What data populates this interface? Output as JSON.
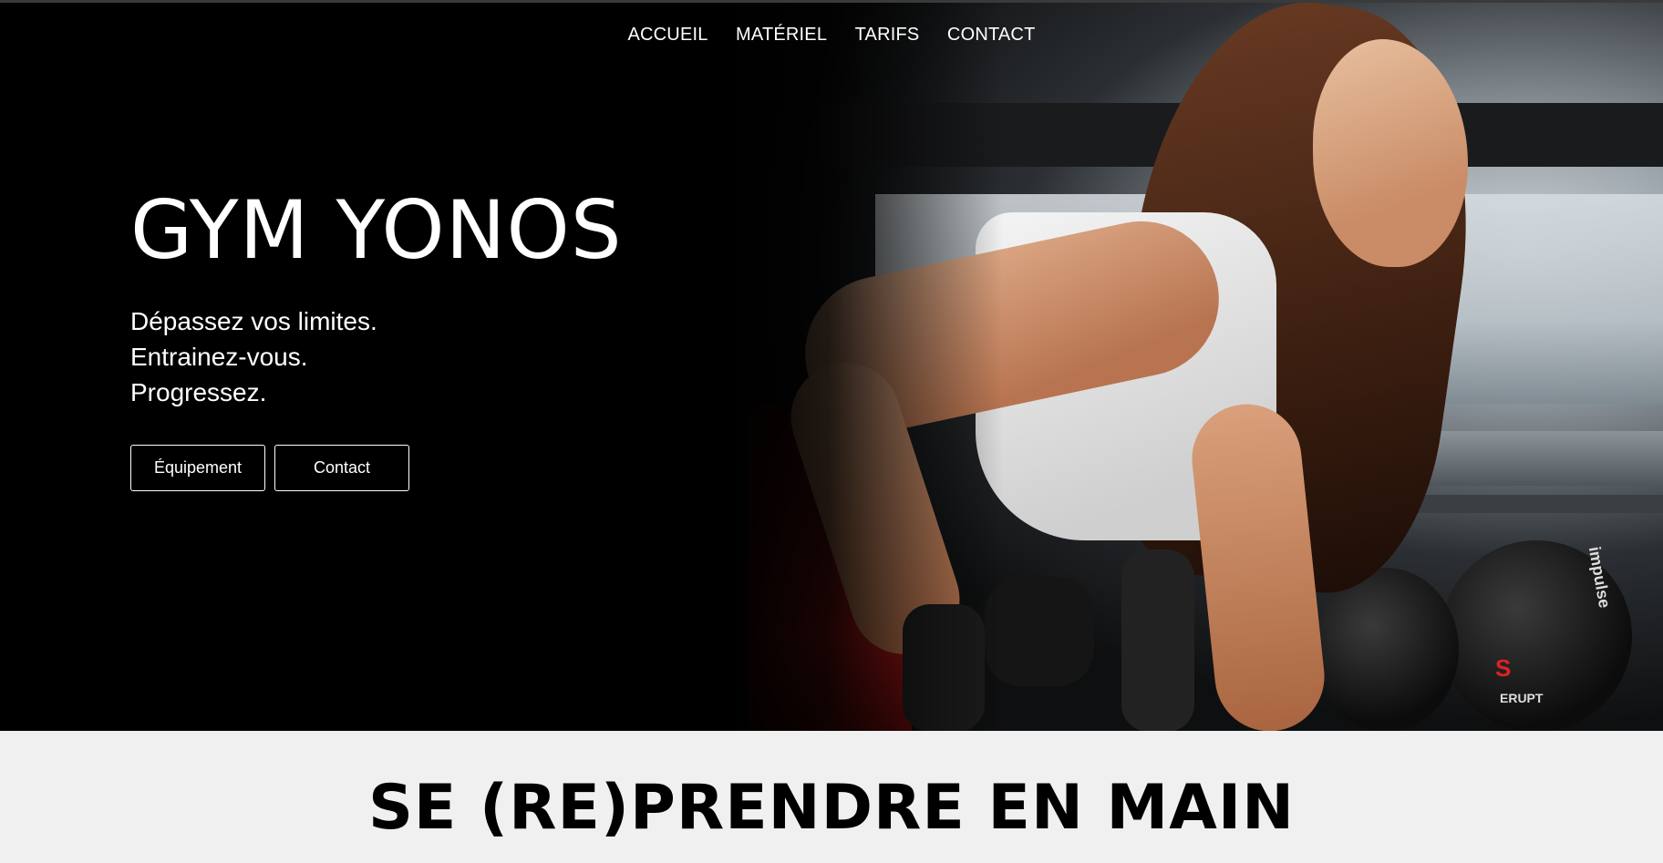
{
  "nav": {
    "items": [
      {
        "label": "ACCUEIL"
      },
      {
        "label": "MATÉRIEL"
      },
      {
        "label": "TARIFS"
      },
      {
        "label": "CONTACT"
      }
    ]
  },
  "hero": {
    "title": "GYM YONOS",
    "tagline": [
      "Dépassez vos limites.",
      "Entrainez-vous.",
      "Progressez."
    ],
    "buttons": [
      {
        "label": "Équipement"
      },
      {
        "label": "Contact"
      }
    ],
    "image": "woman-lifting-dumbbell-photo",
    "plate_brand": "ERUPT",
    "plate_text": "impulse"
  },
  "section": {
    "title": "SE (RE)PRENDRE EN MAIN"
  },
  "colors": {
    "hero_background": "#000000",
    "section_background": "#f0f0f0",
    "text_light": "#ffffff",
    "text_dark": "#000000"
  }
}
